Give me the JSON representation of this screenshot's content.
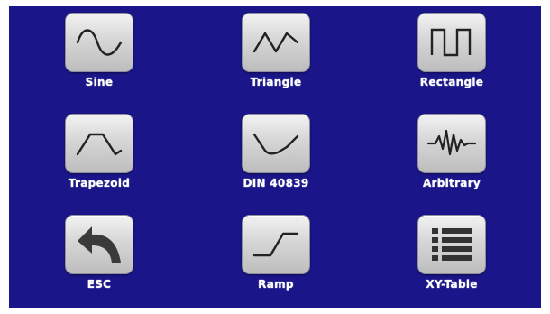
{
  "tiles": [
    {
      "label": "Sine",
      "icon": "sine-wave-icon"
    },
    {
      "label": "Triangle",
      "icon": "triangle-wave-icon"
    },
    {
      "label": "Rectangle",
      "icon": "rectangle-wave-icon"
    },
    {
      "label": "Trapezoid",
      "icon": "trapezoid-wave-icon"
    },
    {
      "label": "DIN 40839",
      "icon": "din-40839-curve-icon"
    },
    {
      "label": "Arbitrary",
      "icon": "arbitrary-wave-icon"
    },
    {
      "label": "ESC",
      "icon": "back-arrow-icon"
    },
    {
      "label": "Ramp",
      "icon": "ramp-icon"
    },
    {
      "label": "XY-Table",
      "icon": "list-icon"
    }
  ],
  "colors": {
    "screen_background": "#1a1689",
    "label_text": "#ffffff",
    "icon_stroke": "#222222"
  }
}
